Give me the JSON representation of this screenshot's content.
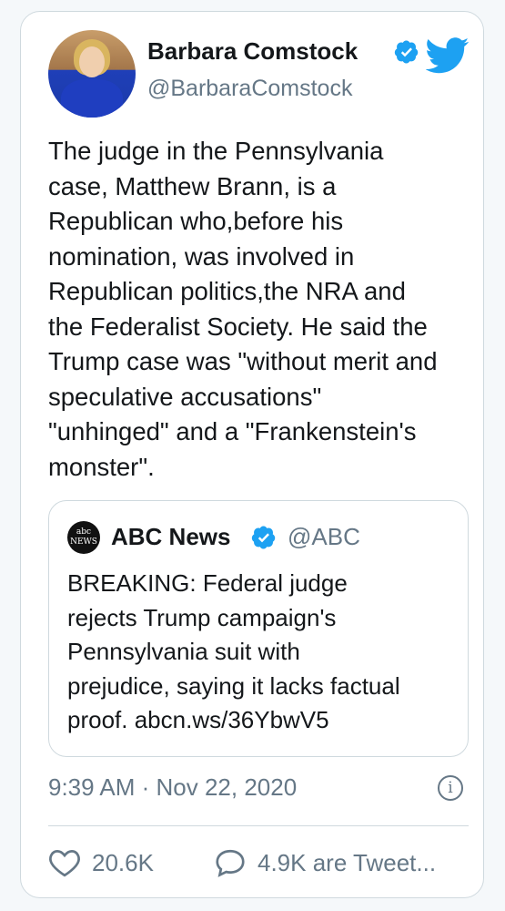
{
  "tweet": {
    "author_name": "Barbara Comstock",
    "author_handle": "@BarbaraComstock",
    "text": "The judge in the Pennsylvania\ncase, Matthew Brann, is a\nRepublican who,before his\nnomination, was involved in\nRepublican politics,the NRA and\nthe Federalist Society. He said the\nTrump case was \"without merit and\nspeculative accusations\"\n\"unhinged\" and a \"Frankenstein's\nmonster\".",
    "timestamp": "9:39 AM · Nov 22, 2020",
    "likes": "20.6K",
    "replies_label": "4.9K are Tweet..."
  },
  "quoted_tweet": {
    "author_name": "ABC News",
    "author_handle": "@ABC",
    "logo_text_top": "abc",
    "logo_text_bottom": "NEWS",
    "text": "BREAKING: Federal judge\nrejects Trump campaign's\nPennsylvania suit with\nprejudice, saying it lacks factual\nproof. abcn.ws/36YbwV5"
  },
  "icons": {
    "verified": "verified-badge-icon",
    "twitter": "twitter-bird-icon",
    "info": "info-icon",
    "like": "heart-icon",
    "reply": "speech-bubble-icon"
  },
  "colors": {
    "verified_blue": "#1da1f2",
    "twitter_blue": "#1da1f2",
    "secondary_text": "#657786"
  }
}
